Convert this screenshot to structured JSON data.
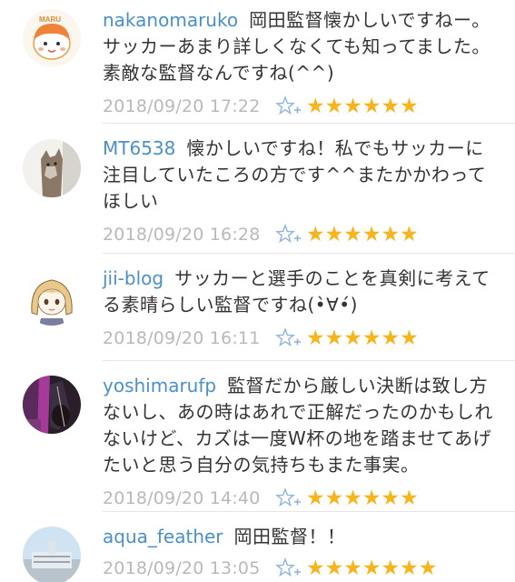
{
  "comments": [
    {
      "user": "nakanomaruko",
      "text": "岡田監督懐かしいですねー。サッカーあまり詳しくなくても知ってました。素敵な監督なんですね(^^)",
      "time": "2018/09/20 17:22",
      "stars": "★★★★★★",
      "avatar_icon": "maru-character-icon"
    },
    {
      "user": "MT6538",
      "text": "懐かしいですね！私でもサッカーに注目していたころの方です^^またかかわってほしい",
      "time": "2018/09/20 16:28",
      "stars": "★★★★★★",
      "avatar_icon": "cat-photo-icon"
    },
    {
      "user": "jii-blog",
      "text": "サッカーと選手のことを真剣に考えてる素晴らしい監督ですね(•̀∀•́)",
      "time": "2018/09/20 16:11",
      "stars": "★★★★★★",
      "avatar_icon": "anime-girl-icon"
    },
    {
      "user": "yoshimarufp",
      "text": "監督だから厳しい決断は致し方ないし、あの時はあれで正解だったのかもしれないけど、カズは一度W杯の地を踏ませてあげたいと思う自分の気持ちもまた事実。",
      "time": "2018/09/20 14:40",
      "stars": "★★★★★★",
      "avatar_icon": "guitar-photo-icon"
    },
    {
      "user": "aqua_feather",
      "text": "岡田監督！！",
      "time": "2018/09/20 13:05",
      "stars": "★★★★★★★",
      "avatar_icon": "building-photo-icon"
    }
  ],
  "colors": {
    "username": "#4a90c8",
    "star": "#f6b51d",
    "timestamp": "#b9b9b9",
    "add_star": "#8fb4e0"
  }
}
